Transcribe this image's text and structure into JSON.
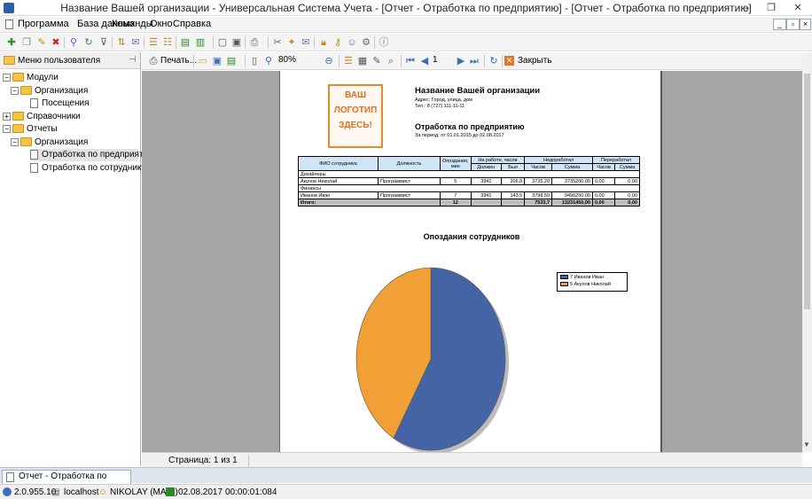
{
  "window": {
    "title": "Название Вашей организации - Универсальная Система Учета - [Отчет - Отработка по предприятию] - [Отчет - Отработка по предприятию]"
  },
  "menu": {
    "items": [
      "Программа",
      "База данных",
      "Команды",
      "Окно",
      "Справка"
    ]
  },
  "left_panel": {
    "title": "Меню пользователя",
    "tree": [
      {
        "label": "Модули",
        "level": 0,
        "type": "folder",
        "expand": "−"
      },
      {
        "label": "Организация",
        "level": 1,
        "type": "folder",
        "expand": "−"
      },
      {
        "label": "Посещения",
        "level": 2,
        "type": "doc"
      },
      {
        "label": "Справочники",
        "level": 0,
        "type": "folder",
        "expand": "+"
      },
      {
        "label": "Отчеты",
        "level": 0,
        "type": "folder",
        "expand": "−"
      },
      {
        "label": "Организация",
        "level": 1,
        "type": "folder",
        "expand": "−"
      },
      {
        "label": "Отработка по предприятию",
        "level": 2,
        "type": "doc",
        "selected": true
      },
      {
        "label": "Отработка по сотруднику",
        "level": 2,
        "type": "doc"
      }
    ]
  },
  "report_toolbar": {
    "print": "Печать...",
    "zoom": "80%",
    "page": "1",
    "close": "Закрыть"
  },
  "report": {
    "logo": "ВАШ ЛОГОТИП ЗДЕСЬ!",
    "org_name": "Название Вашей организации",
    "address": "Адрес: Город, улица, дом",
    "phone": "Тел.: 8 (727) 111-11-11",
    "title": "Отработка по предприятию",
    "period": "За период: от 01.01.2015 до 02.08.2017",
    "headers": {
      "fio": "ФИО сотрудника",
      "position": "Должность",
      "late": "Опоздания, мин",
      "at_work": "На работе, часов",
      "must": "Должен",
      "was": "Был",
      "under": "Недоработал",
      "over": "Переработал",
      "hours": "Часов",
      "sum": "Сумма"
    },
    "groups": [
      {
        "name": "Дизайнеры",
        "rows": [
          {
            "fio": "Акулов Николай",
            "position": "Программист",
            "late": "5",
            "must": "3942",
            "was": "206,8",
            "u_hours": "3735,20",
            "u_sum": "3735200,00",
            "o_hours": "0,00",
            "o_sum": "0,00"
          }
        ]
      },
      {
        "name": "Финансы",
        "rows": [
          {
            "fio": "Иванов Иван",
            "position": "Программист",
            "late": "7",
            "must": "3942",
            "was": "143,5",
            "u_hours": "3798,50",
            "u_sum": "9496250,00",
            "o_hours": "0,00",
            "o_sum": "0,00"
          }
        ]
      }
    ],
    "total": {
      "label": "Итого:",
      "late": "12",
      "u_hours": "7533,7",
      "u_sum": "13231450,00",
      "o_hours": "0,00",
      "o_sum": "0,00"
    },
    "chart_data": {
      "type": "pie",
      "title": "Опоздания сотрудников",
      "categories": [
        "Иванов Иван",
        "Акулов Николай"
      ],
      "values": [
        7,
        5
      ],
      "legend": [
        "7 Иванов Иван",
        "5 Акулов Николай"
      ],
      "colors": [
        "#4464a6",
        "#f0a035"
      ],
      "legend_placement": "right"
    }
  },
  "page_status": "Страница: 1 из 1",
  "tab": {
    "label": "Отчет - Отработка по предприятию"
  },
  "statusbar": {
    "version": "2.0.955.10",
    "server": "localhost",
    "user": "NIKOLAY (MAIN)",
    "date": "02.08.2017",
    "time": "00:00:01:084"
  },
  "colors": {
    "accent": "#cfe4f7",
    "folder": "#f6c445"
  }
}
